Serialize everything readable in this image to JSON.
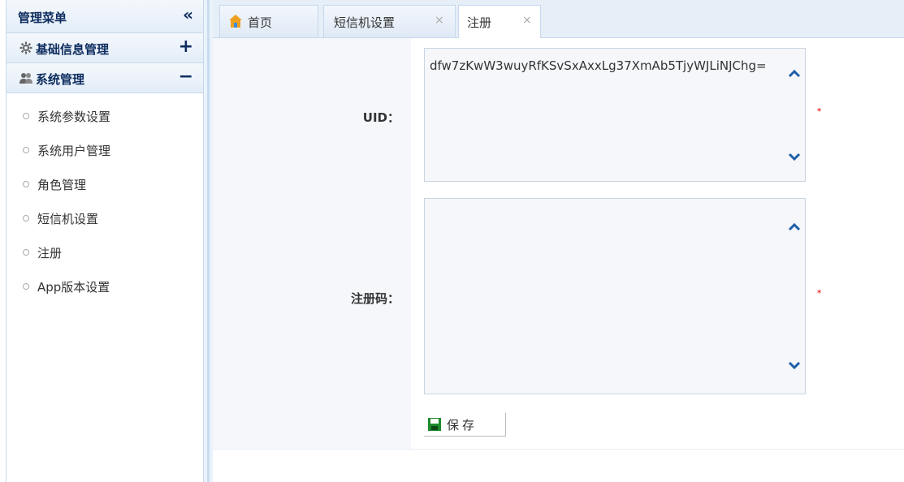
{
  "sidebar": {
    "title": "管理菜单",
    "collapse_icon": "«",
    "panels": [
      {
        "title": "基础信息管理",
        "toggle": "+"
      },
      {
        "title": "系统管理",
        "toggle": "−"
      }
    ],
    "items": [
      {
        "label": "系统参数设置"
      },
      {
        "label": "系统用户管理"
      },
      {
        "label": "角色管理"
      },
      {
        "label": "短信机设置"
      },
      {
        "label": "注册"
      },
      {
        "label": "App版本设置"
      }
    ]
  },
  "tabs": [
    {
      "label": "首页",
      "closable": false,
      "icon": "home-icon"
    },
    {
      "label": "短信机设置",
      "closable": true
    },
    {
      "label": "注册",
      "closable": true,
      "active": true
    }
  ],
  "tab_close_glyph": "×",
  "form": {
    "uid_label": "UID：",
    "uid_value": "dfw7zKwW3wuyRfKSvSxAxxLg37XmAb5TjyWJLiNJChg=",
    "code_label": "注册码：",
    "code_value": "",
    "required_mark": "*",
    "save_label": "保存"
  },
  "colors": {
    "accent": "#0e2d5f",
    "required": "#e33333",
    "border": "#c6d9ec"
  }
}
